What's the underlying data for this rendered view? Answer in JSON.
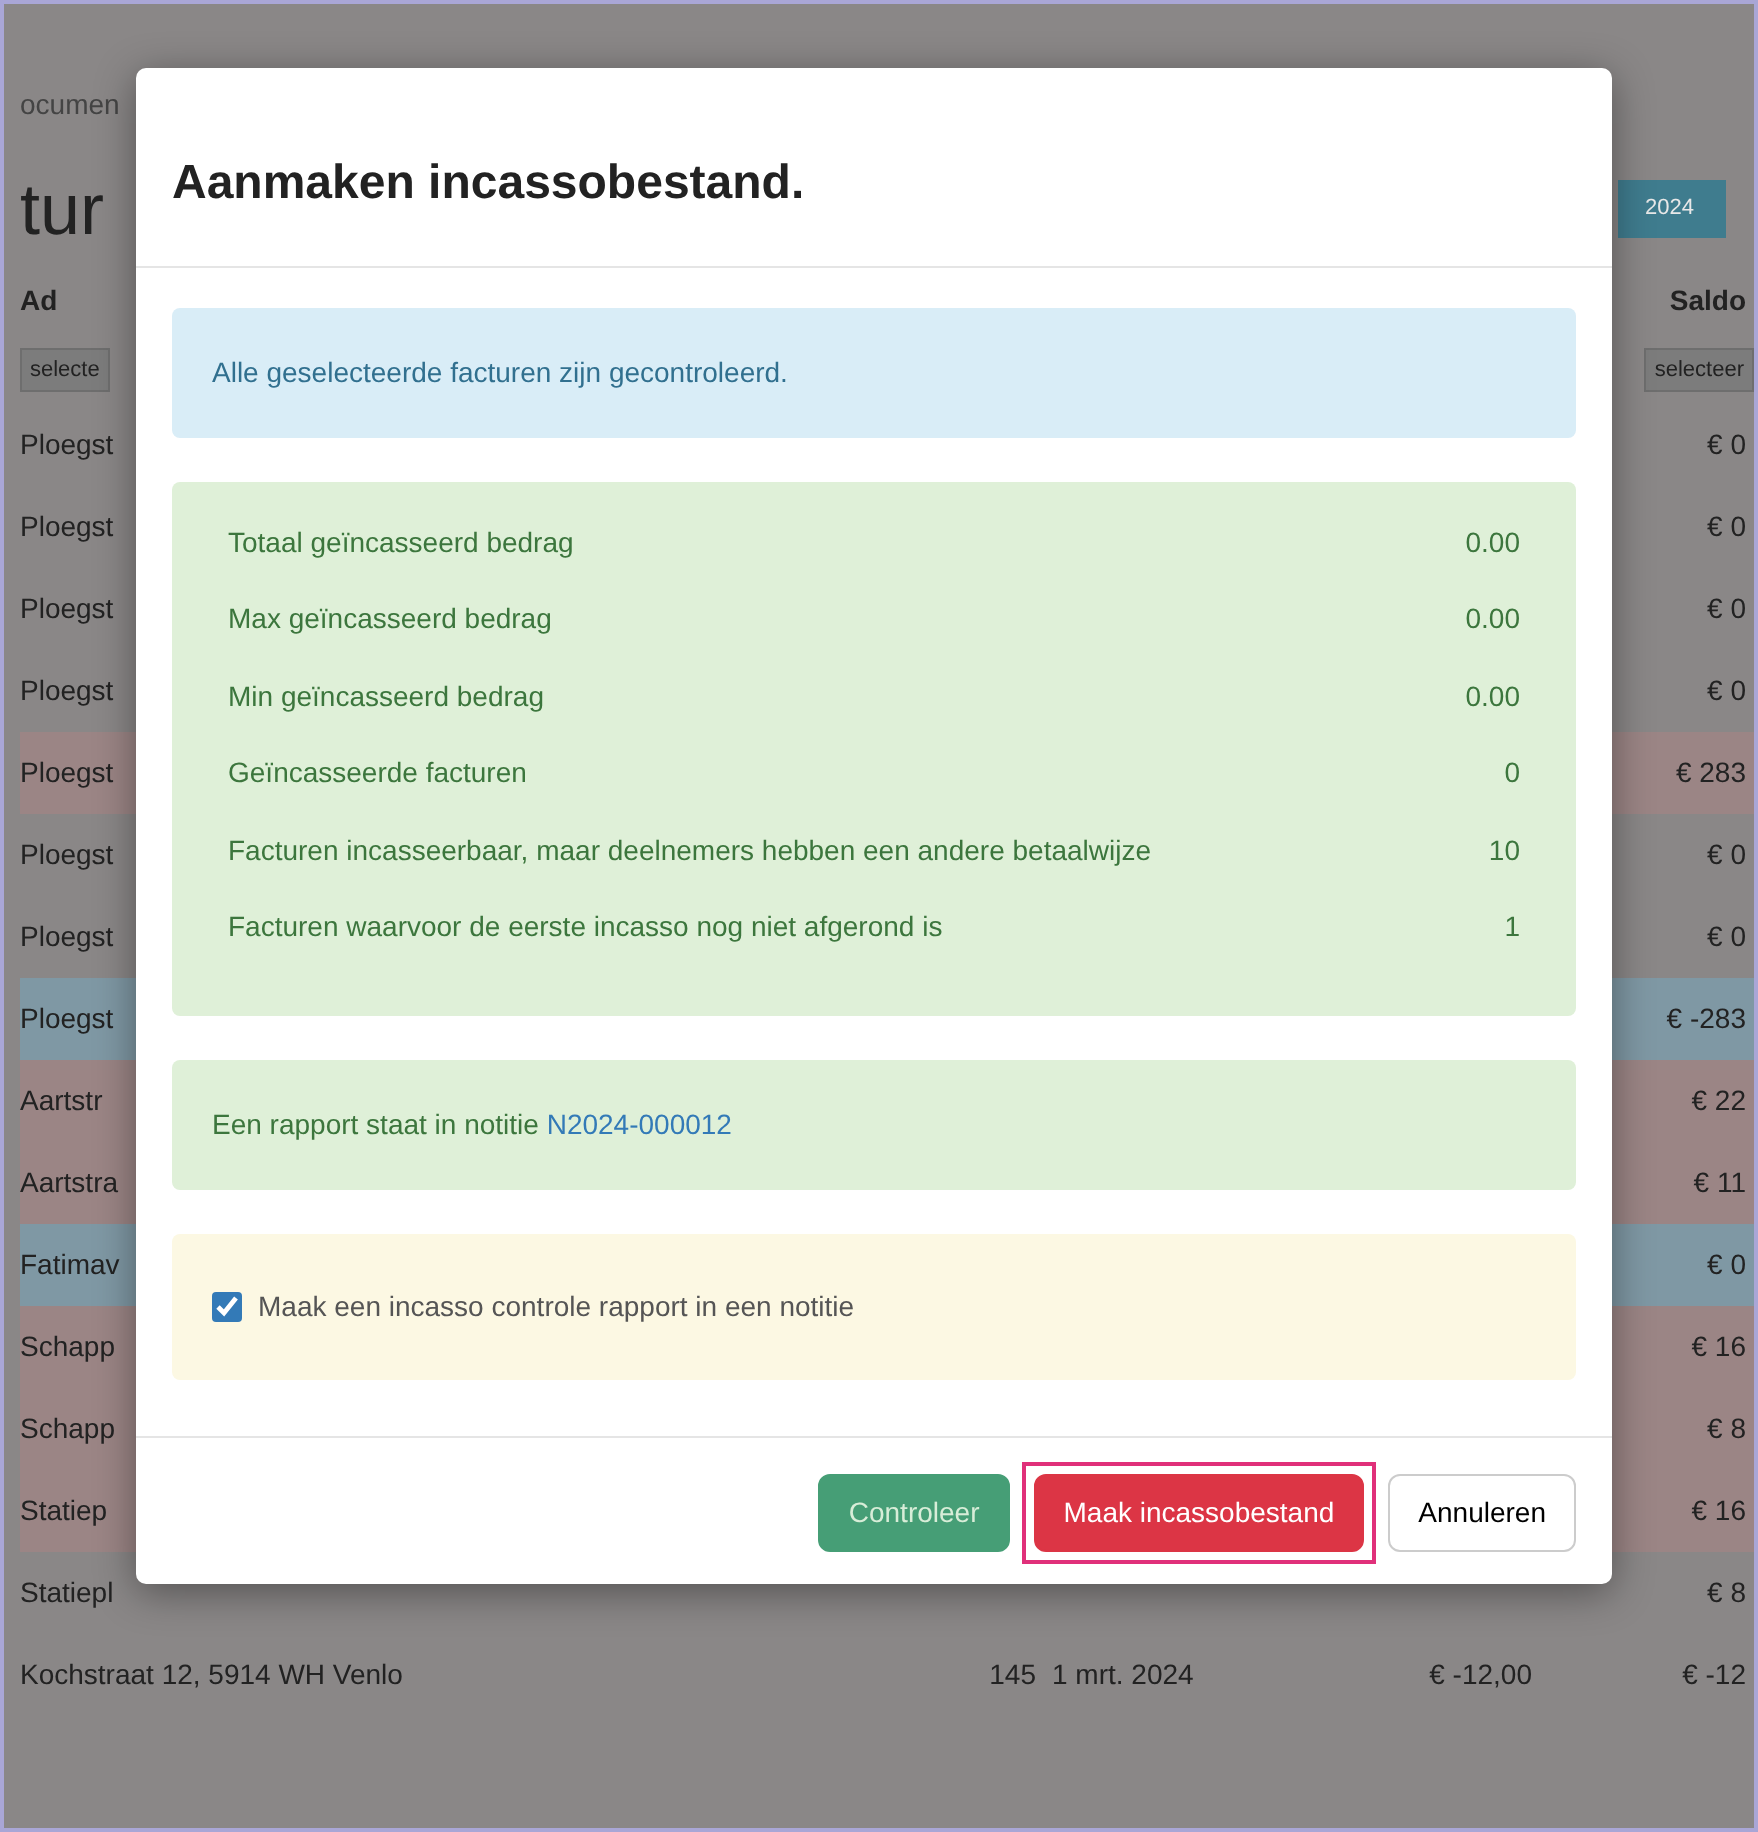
{
  "background": {
    "breadcrumb": "ocumen",
    "heading": "tur",
    "year": "2024",
    "col_left": "Ad",
    "col_right": "Saldo",
    "select_left": "selecte",
    "select_right": "selecteer",
    "rows": [
      {
        "left": "Ploegst",
        "right": "€ 0"
      },
      {
        "left": "Ploegst",
        "right": "€ 0"
      },
      {
        "left": "Ploegst",
        "right": "€ 0"
      },
      {
        "left": "Ploegst",
        "right": "€ 0"
      },
      {
        "left": "Ploegst",
        "right": "€ 283",
        "color": "#9b8585"
      },
      {
        "left": "Ploegst",
        "right": "€ 0"
      },
      {
        "left": "Ploegst",
        "right": "€ 0"
      },
      {
        "left": "Ploegst",
        "right": "€ -283",
        "color": "#7f98a4"
      },
      {
        "left": "Aartstr",
        "right": "€ 22",
        "color": "#9b8585"
      },
      {
        "left": "Aartstra",
        "right": "€ 11",
        "color": "#9b8585"
      },
      {
        "left": "Fatimav",
        "right": "€ 0",
        "color": "#7f98a4"
      },
      {
        "left": "Schapp",
        "right": "€ 16",
        "color": "#9b8585"
      },
      {
        "left": "Schapp",
        "right": "€ 8",
        "color": "#9b8585"
      },
      {
        "left": "Statiep",
        "right": "€ 16",
        "color": "#9b8585"
      },
      {
        "left": "Statiepl",
        "right": "€ 8"
      }
    ],
    "last_row": {
      "address": "Kochstraat 12, 5914 WH Venlo",
      "number": "145",
      "date": "1 mrt. 2024",
      "amount": "€ -12,00",
      "saldo": "€ -12"
    }
  },
  "modal": {
    "title": "Aanmaken incassobestand.",
    "info": "Alle geselecteerde facturen zijn gecontroleerd.",
    "stats": [
      {
        "label": "Totaal geïncasseerd bedrag",
        "value": "0.00"
      },
      {
        "label": "Max geïncasseerd bedrag",
        "value": "0.00"
      },
      {
        "label": "Min geïncasseerd bedrag",
        "value": "0.00"
      },
      {
        "label": "Geïncasseerde facturen",
        "value": "0"
      },
      {
        "label": "Facturen incasseerbaar, maar deelnemers hebben een andere betaalwijze",
        "value": "10"
      },
      {
        "label": "Facturen waarvoor de eerste incasso nog niet afgerond is",
        "value": "1"
      }
    ],
    "report": {
      "text": "Een rapport staat in notitie",
      "link": "N2024-000012"
    },
    "option": {
      "label": "Maak een incasso controle rapport in een notitie",
      "checked": true
    },
    "buttons": [
      {
        "label": "Controleer",
        "kind": "success",
        "disabled": true,
        "focused": false
      },
      {
        "label": "Maak incassobestand",
        "kind": "danger",
        "disabled": false,
        "focused": true
      },
      {
        "label": "Annuleren",
        "kind": "light",
        "disabled": false,
        "focused": false
      }
    ]
  }
}
